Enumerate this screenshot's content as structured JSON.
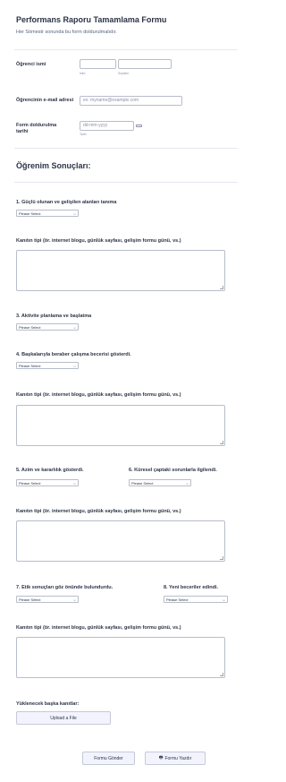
{
  "header": {
    "title": "Performans Raporu Tamamlama Formu",
    "subtitle": "Her Sömestr sonunda bu form doldurulmalıdır."
  },
  "student_name": {
    "label": "Öğrenci ismi",
    "first_sublabel": "İsim",
    "last_sublabel": "Soyisim"
  },
  "email": {
    "label": "Öğrencinin e-mail adresi",
    "placeholder": "ex: myname@example.com"
  },
  "date": {
    "label": "Form doldurulma tarihi",
    "placeholder": "dd-mm-yyyy",
    "sublabel": "Tarih",
    "icon": "calendar-icon"
  },
  "outcomes": {
    "heading": "Öğrenim Sonuçları:",
    "select_default": "Please Select",
    "evidence_label": "Kanıtın tipi (ör. internet blogu, günlük sayfası, gelişim formu günü, vs.)",
    "q1": "1. Güçlü olunan ve gelişilen alanları tanıma",
    "q3": "3. Aktivite planlama ve başlatma",
    "q4": "4. Başkalarıyla beraber çalışma becerisi gösterdi.",
    "q5": "5. Azim ve kararlılık gösterdi.",
    "q6": "6. Küresel çaptaki sorunlarla ilgilendi.",
    "q7": "7. Etik sonuçları göz önünde bulundurdu.",
    "q8": "8. Yeni beceriler edindi."
  },
  "upload": {
    "label": "Yüklenecek başka kanıtlar:",
    "button": "Upload a File"
  },
  "actions": {
    "submit": "Formu Gönder",
    "print": "Formu Yazdır"
  }
}
